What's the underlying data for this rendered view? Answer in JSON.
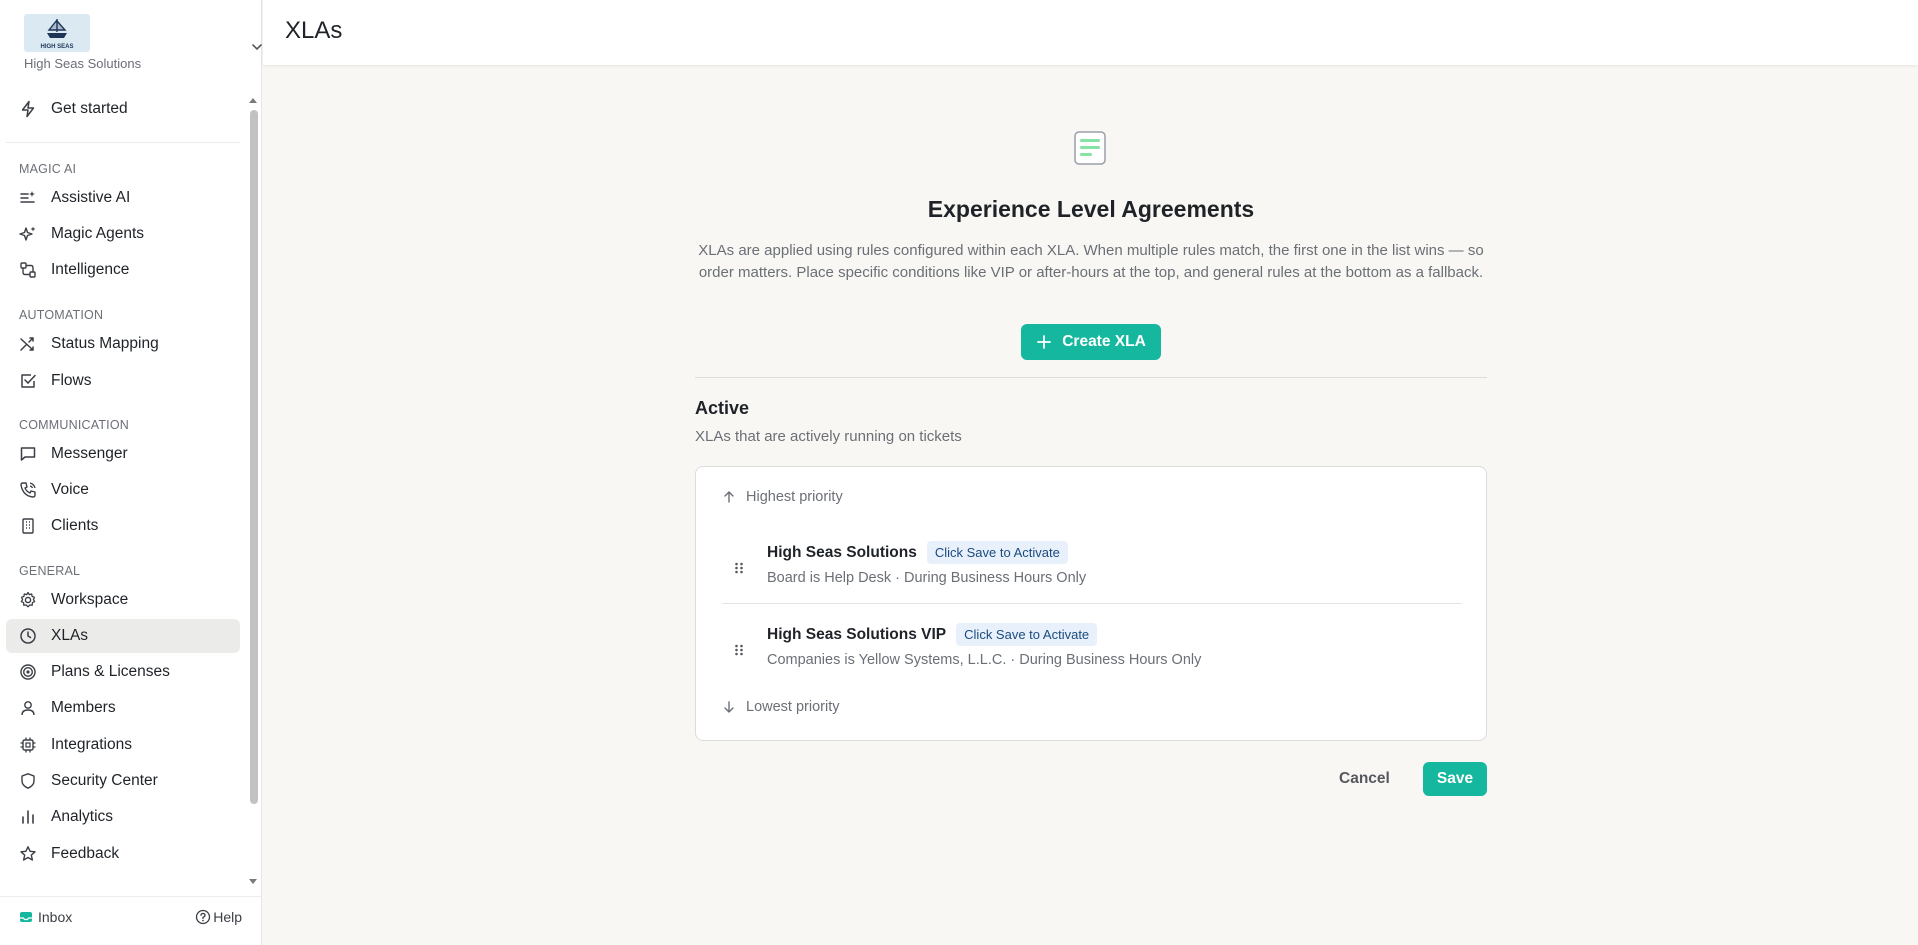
{
  "org": {
    "name": "High Seas Solutions",
    "logo_text": "HIGH SEAS"
  },
  "sidebar": {
    "get_started": "Get started",
    "sections": {
      "magic_ai": "MAGIC AI",
      "automation": "AUTOMATION",
      "communication": "COMMUNICATION",
      "general": "GENERAL"
    },
    "items": {
      "assistive_ai": "Assistive AI",
      "magic_agents": "Magic Agents",
      "intelligence": "Intelligence",
      "status_mapping": "Status Mapping",
      "flows": "Flows",
      "messenger": "Messenger",
      "voice": "Voice",
      "clients": "Clients",
      "workspace": "Workspace",
      "xlas": "XLAs",
      "plans": "Plans & Licenses",
      "members": "Members",
      "integrations": "Integrations",
      "security": "Security Center",
      "analytics": "Analytics",
      "feedback": "Feedback"
    },
    "active_item": "XLAs",
    "footer": {
      "inbox": "Inbox",
      "help": "Help"
    }
  },
  "header": {
    "title": "XLAs"
  },
  "main": {
    "title": "Experience Level Agreements",
    "description": "XLAs are applied using rules configured within each XLA. When multiple rules match, the first one in the list wins — so order matters. Place specific conditions like VIP or after-hours at the top, and general rules at the bottom as a fallback.",
    "create_button": "Create XLA",
    "active_section": {
      "title": "Active",
      "subtitle": "XLAs that are actively running on tickets",
      "highest_label": "Highest priority",
      "lowest_label": "Lowest priority",
      "rows": [
        {
          "name": "High Seas Solutions",
          "badge": "Click Save to Activate",
          "meta": "Board is Help Desk · During Business Hours Only"
        },
        {
          "name": "High Seas Solutions VIP",
          "badge": "Click Save to Activate",
          "meta": "Companies is Yellow Systems, L.L.C. · During Business Hours Only"
        }
      ]
    },
    "cancel": "Cancel",
    "save": "Save"
  },
  "colors": {
    "accent": "#15b79e",
    "badge_bg": "#e8f1fb",
    "badge_text": "#1c4a7e"
  }
}
